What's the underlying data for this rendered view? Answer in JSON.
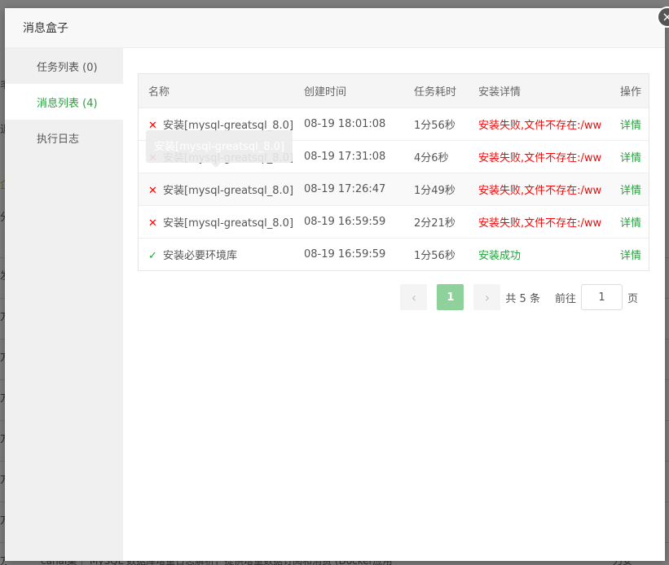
{
  "modal": {
    "title": "消息盒子",
    "close_glyph": "×"
  },
  "nav": [
    {
      "label": "任务列表 (0)",
      "active": false
    },
    {
      "label": "消息列表 (4)",
      "active": true
    },
    {
      "label": "执行日志",
      "active": false
    }
  ],
  "table": {
    "headers": [
      "名称",
      "创建时间",
      "任务耗时",
      "安装详情",
      "操作"
    ],
    "rows": [
      {
        "status": "fail",
        "icon": "✕",
        "name": "安装[mysql-greatsql_8.0]",
        "created": "08-19 18:01:08",
        "duration": "1分56秒",
        "detail": "安装失败,文件不存在:/ww",
        "action": "详情"
      },
      {
        "status": "fail",
        "icon": "✕",
        "name": "安装[mysql-greatsql_8.0]",
        "created": "08-19 17:31:08",
        "duration": "4分6秒",
        "detail": "安装失败,文件不存在:/ww",
        "action": "详情"
      },
      {
        "status": "fail",
        "icon": "✕",
        "name": "安装[mysql-greatsql_8.0]",
        "created": "08-19 17:26:47",
        "duration": "1分49秒",
        "detail": "安装失败,文件不存在:/ww",
        "action": "详情"
      },
      {
        "status": "fail",
        "icon": "✕",
        "name": "安装[mysql-greatsql_8.0]",
        "created": "08-19 16:59:59",
        "duration": "2分21秒",
        "detail": "安装失败,文件不存在:/ww",
        "action": "详情"
      },
      {
        "status": "ok",
        "icon": "✓",
        "name": "安装必要环境库",
        "created": "08-19 16:59:59",
        "duration": "1分56秒",
        "detail": "安装成功",
        "action": "详情"
      }
    ]
  },
  "tooltip": {
    "text": "安装[mysql-greatsql_8.0]"
  },
  "pagination": {
    "prev_glyph": "‹",
    "next_glyph": "›",
    "current_page": "1",
    "total_text": "共 5 条",
    "goto_label": "前往",
    "goto_value": "1",
    "unit_label": "页"
  },
  "background": {
    "footer_text": "canal集｜ MySQL 数据库增量日志解析，提供增量数据订阅和消费 (Docker应用",
    "right_text": "刀安"
  },
  "colors": {
    "accent": "#20a53a",
    "error": "#ef0808"
  }
}
